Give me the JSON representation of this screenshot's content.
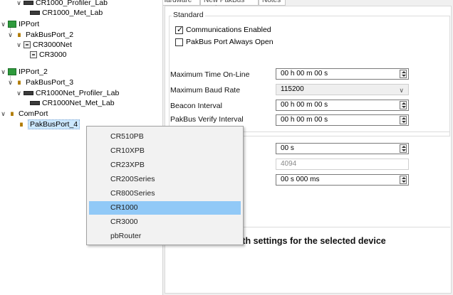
{
  "tree": {
    "items": [
      {
        "label": "CR1000_Profiler_Lab"
      },
      {
        "label": "CR1000_Met_Lab"
      },
      {
        "label": "IPPort"
      },
      {
        "label": "PakBusPort_2"
      },
      {
        "label": "CR3000Net"
      },
      {
        "label": "CR3000"
      },
      {
        "label": "IPPort_2"
      },
      {
        "label": "PakBusPort_3"
      },
      {
        "label": "CR1000Net_Profiler_Lab"
      },
      {
        "label": "CR1000Net_Met_Lab"
      },
      {
        "label": "ComPort"
      },
      {
        "label": "PakBusPort_4"
      }
    ]
  },
  "tabs": [
    "Hardware",
    "New PakBus Nodes",
    "Notes"
  ],
  "standard": {
    "title": "Standard",
    "comm_enabled": {
      "label": "Communications Enabled",
      "checked": true
    },
    "always_open": {
      "label": "PakBus Port Always Open",
      "checked": false
    },
    "fields": [
      {
        "label": "Maximum Time On-Line",
        "value": "00 h 00 m 00 s"
      },
      {
        "label": "Maximum Baud Rate",
        "value": "115200"
      },
      {
        "label": "Beacon Interval",
        "value": "00 h 00 m 00 s"
      },
      {
        "label": "PakBus Verify Interval",
        "value": "00 h 00 m 00 s"
      }
    ]
  },
  "advanced": {
    "fields": [
      {
        "value": "00 s"
      },
      {
        "value": "4094"
      },
      {
        "value": "00 s 000 ms"
      }
    ]
  },
  "bottom_note": "d with settings for the selected device",
  "menu": {
    "items": [
      "CR510PB",
      "CR10XPB",
      "CR23XPB",
      "CR200Series",
      "CR800Series",
      "CR1000",
      "CR3000",
      "pbRouter"
    ],
    "highlighted": "CR1000"
  },
  "colors": {
    "menu_highlight": "#91c9f7",
    "selection": "#cce8ff"
  }
}
